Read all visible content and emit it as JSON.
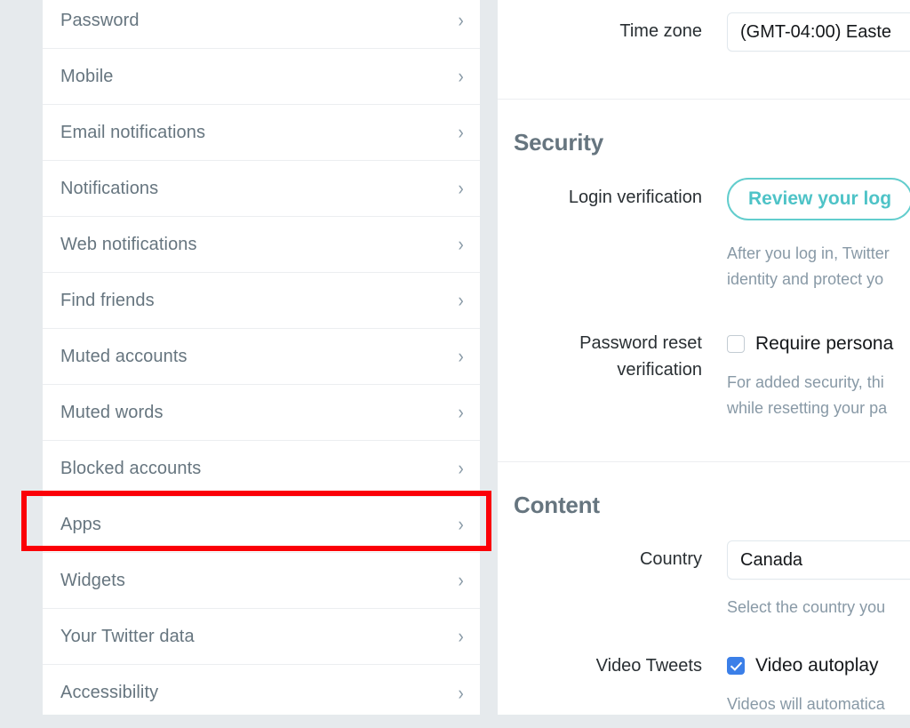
{
  "sidebar": {
    "items": [
      {
        "label": "Password",
        "chevron": "chevron-right-icon"
      },
      {
        "label": "Mobile",
        "chevron": "chevron-right-icon"
      },
      {
        "label": "Email notifications",
        "chevron": "chevron-right-icon"
      },
      {
        "label": "Notifications",
        "chevron": "chevron-right-icon"
      },
      {
        "label": "Web notifications",
        "chevron": "chevron-right-icon"
      },
      {
        "label": "Find friends",
        "chevron": "chevron-right-icon"
      },
      {
        "label": "Muted accounts",
        "chevron": "chevron-right-icon"
      },
      {
        "label": "Muted words",
        "chevron": "chevron-right-icon"
      },
      {
        "label": "Blocked accounts",
        "chevron": "chevron-right-icon"
      },
      {
        "label": "Apps",
        "chevron": "chevron-right-icon"
      },
      {
        "label": "Widgets",
        "chevron": "chevron-right-icon"
      },
      {
        "label": "Your Twitter data",
        "chevron": "chevron-right-icon"
      },
      {
        "label": "Accessibility",
        "chevron": "chevron-right-icon"
      }
    ],
    "chevron_glyph": "›"
  },
  "annotation": {
    "target_item": "Apps",
    "color": "#fb0007"
  },
  "content": {
    "timezone": {
      "label": "Time zone",
      "value": "(GMT-04:00) Easte"
    },
    "security": {
      "title": "Security",
      "login_verification": {
        "label": "Login verification",
        "button_label": "Review your log",
        "help_line_1": "After you log in, Twitter",
        "help_line_2": "identity and protect yo"
      },
      "password_reset": {
        "label_line_1": "Password reset",
        "label_line_2": "verification",
        "checkbox_label": "Require persona",
        "checked": false,
        "help_line_1": "For added security, thi",
        "help_line_2": "while resetting your pa"
      }
    },
    "content_section": {
      "title": "Content",
      "country": {
        "label": "Country",
        "value": "Canada",
        "help": "Select the country you"
      },
      "video_tweets": {
        "label": "Video Tweets",
        "checkbox_label": "Video autoplay",
        "checked": true,
        "help": "Videos will automatica"
      }
    }
  },
  "colors": {
    "accent_teal": "#4ec3c7",
    "checkbox_blue": "#3b7fe8",
    "nav_text": "#66757f",
    "page_background": "#e6eaed",
    "annotation_red": "#fb0007"
  }
}
